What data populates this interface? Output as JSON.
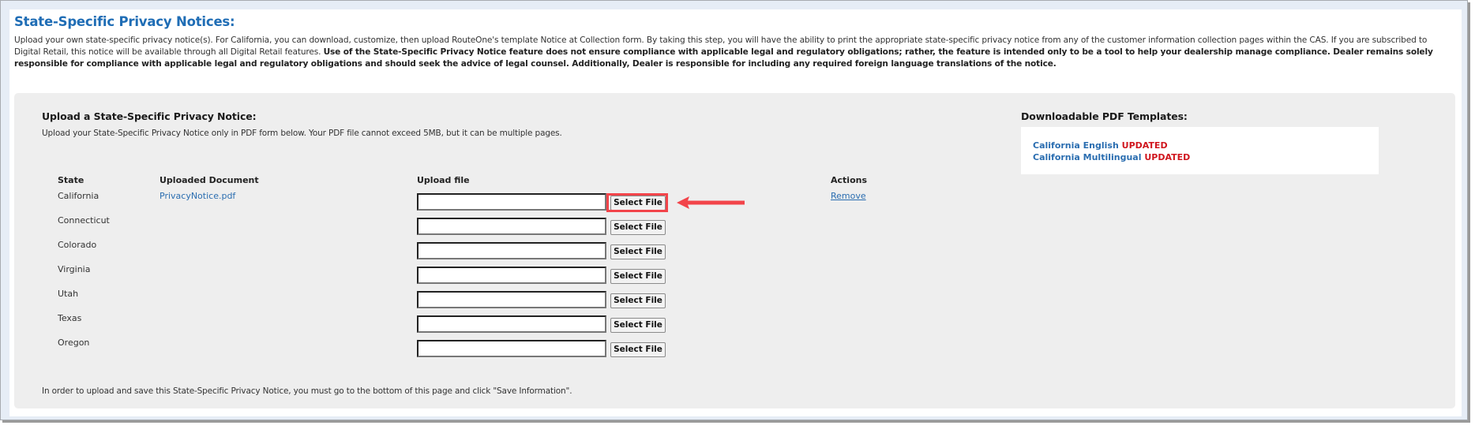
{
  "page": {
    "title": "State-Specific Privacy Notices:",
    "intro_plain": "Upload your own state-specific privacy notice(s). For California, you can download, customize, then upload RouteOne's template Notice at Collection form. By taking this step, you will have the ability to print the appropriate state-specific privacy notice from any of the customer information collection pages within the CAS. If you are subscribed to Digital Retail, this notice will be available through all Digital Retail features. ",
    "intro_bold": "Use of the State-Specific Privacy Notice feature does not ensure compliance with applicable legal and regulatory obligations; rather, the feature is intended only to be a tool to help your dealership manage compliance. Dealer remains solely responsible for compliance with applicable legal and regulatory obligations and should seek the advice of legal counsel. Additionally, Dealer is responsible for including any required foreign language translations of the notice."
  },
  "upload_section": {
    "title": "Upload a State-Specific Privacy Notice:",
    "instructions": "Upload your State-Specific Privacy Notice only in PDF form below. Your PDF file cannot exceed 5MB, but it can be multiple pages.",
    "columns": {
      "state": "State",
      "uploaded_document": "Uploaded Document",
      "upload_file": "Upload file",
      "actions": "Actions"
    },
    "rows": [
      {
        "state": "California",
        "document": "PrivacyNotice.pdf",
        "file_value": "",
        "button": "Select File",
        "action": "Remove"
      },
      {
        "state": "Connecticut",
        "document": "",
        "file_value": "",
        "button": "Select File",
        "action": ""
      },
      {
        "state": "Colorado",
        "document": "",
        "file_value": "",
        "button": "Select File",
        "action": ""
      },
      {
        "state": "Virginia",
        "document": "",
        "file_value": "",
        "button": "Select File",
        "action": ""
      },
      {
        "state": "Utah",
        "document": "",
        "file_value": "",
        "button": "Select File",
        "action": ""
      },
      {
        "state": "Texas",
        "document": "",
        "file_value": "",
        "button": "Select File",
        "action": ""
      },
      {
        "state": "Oregon",
        "document": "",
        "file_value": "",
        "button": "Select File",
        "action": ""
      }
    ],
    "footnote": "In order to upload and save this State-Specific Privacy Notice, you must go to the bottom of this page and click \"Save Information\"."
  },
  "templates": {
    "title": "Downloadable PDF Templates:",
    "items": [
      {
        "label": "California English",
        "badge": "UPDATED"
      },
      {
        "label": "California Multilingual",
        "badge": "UPDATED"
      }
    ]
  },
  "annotation": {
    "highlight_color": "#f2444a",
    "arrow_icon": "left-arrow-icon"
  },
  "colors": {
    "link": "#2a6db0",
    "title": "#1f6db5",
    "badge": "#d0161e",
    "section_bg": "#eeeeee"
  }
}
